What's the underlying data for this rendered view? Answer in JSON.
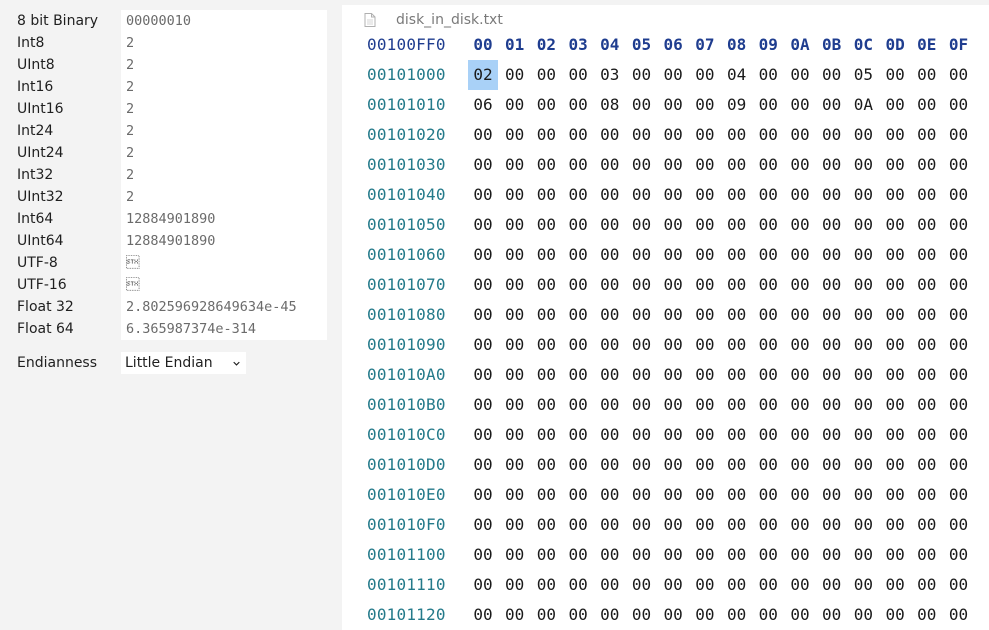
{
  "inspector": {
    "rows": [
      {
        "label": "8 bit Binary",
        "value": "00000010"
      },
      {
        "label": "Int8",
        "value": "2"
      },
      {
        "label": "UInt8",
        "value": "2"
      },
      {
        "label": "Int16",
        "value": "2"
      },
      {
        "label": "UInt16",
        "value": "2"
      },
      {
        "label": "Int24",
        "value": "2"
      },
      {
        "label": "UInt24",
        "value": "2"
      },
      {
        "label": "Int32",
        "value": "2"
      },
      {
        "label": "UInt32",
        "value": "2"
      },
      {
        "label": "Int64",
        "value": "12884901890"
      },
      {
        "label": "UInt64",
        "value": "12884901890"
      },
      {
        "label": "UTF-8",
        "value": "\u0002"
      },
      {
        "label": "UTF-16",
        "value": "\u0002"
      },
      {
        "label": "Float 32",
        "value": "2.802596928649634e-45"
      },
      {
        "label": "Float 64",
        "value": "6.365987374e-314"
      }
    ],
    "endianness": {
      "label": "Endianness",
      "selected": "Little Endian"
    }
  },
  "editor": {
    "tab_title": "disk_in_disk.txt",
    "header": {
      "address": "00100FF0",
      "columns": [
        "00",
        "01",
        "02",
        "03",
        "04",
        "05",
        "06",
        "07",
        "08",
        "09",
        "0A",
        "0B",
        "0C",
        "0D",
        "0E",
        "0F"
      ]
    },
    "selected": {
      "row": 0,
      "col": 0
    },
    "rows": [
      {
        "address": "00101000",
        "bytes": [
          "02",
          "00",
          "00",
          "00",
          "03",
          "00",
          "00",
          "00",
          "04",
          "00",
          "00",
          "00",
          "05",
          "00",
          "00",
          "00"
        ]
      },
      {
        "address": "00101010",
        "bytes": [
          "06",
          "00",
          "00",
          "00",
          "08",
          "00",
          "00",
          "00",
          "09",
          "00",
          "00",
          "00",
          "0A",
          "00",
          "00",
          "00"
        ]
      },
      {
        "address": "00101020",
        "bytes": [
          "00",
          "00",
          "00",
          "00",
          "00",
          "00",
          "00",
          "00",
          "00",
          "00",
          "00",
          "00",
          "00",
          "00",
          "00",
          "00"
        ]
      },
      {
        "address": "00101030",
        "bytes": [
          "00",
          "00",
          "00",
          "00",
          "00",
          "00",
          "00",
          "00",
          "00",
          "00",
          "00",
          "00",
          "00",
          "00",
          "00",
          "00"
        ]
      },
      {
        "address": "00101040",
        "bytes": [
          "00",
          "00",
          "00",
          "00",
          "00",
          "00",
          "00",
          "00",
          "00",
          "00",
          "00",
          "00",
          "00",
          "00",
          "00",
          "00"
        ]
      },
      {
        "address": "00101050",
        "bytes": [
          "00",
          "00",
          "00",
          "00",
          "00",
          "00",
          "00",
          "00",
          "00",
          "00",
          "00",
          "00",
          "00",
          "00",
          "00",
          "00"
        ]
      },
      {
        "address": "00101060",
        "bytes": [
          "00",
          "00",
          "00",
          "00",
          "00",
          "00",
          "00",
          "00",
          "00",
          "00",
          "00",
          "00",
          "00",
          "00",
          "00",
          "00"
        ]
      },
      {
        "address": "00101070",
        "bytes": [
          "00",
          "00",
          "00",
          "00",
          "00",
          "00",
          "00",
          "00",
          "00",
          "00",
          "00",
          "00",
          "00",
          "00",
          "00",
          "00"
        ]
      },
      {
        "address": "00101080",
        "bytes": [
          "00",
          "00",
          "00",
          "00",
          "00",
          "00",
          "00",
          "00",
          "00",
          "00",
          "00",
          "00",
          "00",
          "00",
          "00",
          "00"
        ]
      },
      {
        "address": "00101090",
        "bytes": [
          "00",
          "00",
          "00",
          "00",
          "00",
          "00",
          "00",
          "00",
          "00",
          "00",
          "00",
          "00",
          "00",
          "00",
          "00",
          "00"
        ]
      },
      {
        "address": "001010A0",
        "bytes": [
          "00",
          "00",
          "00",
          "00",
          "00",
          "00",
          "00",
          "00",
          "00",
          "00",
          "00",
          "00",
          "00",
          "00",
          "00",
          "00"
        ]
      },
      {
        "address": "001010B0",
        "bytes": [
          "00",
          "00",
          "00",
          "00",
          "00",
          "00",
          "00",
          "00",
          "00",
          "00",
          "00",
          "00",
          "00",
          "00",
          "00",
          "00"
        ]
      },
      {
        "address": "001010C0",
        "bytes": [
          "00",
          "00",
          "00",
          "00",
          "00",
          "00",
          "00",
          "00",
          "00",
          "00",
          "00",
          "00",
          "00",
          "00",
          "00",
          "00"
        ]
      },
      {
        "address": "001010D0",
        "bytes": [
          "00",
          "00",
          "00",
          "00",
          "00",
          "00",
          "00",
          "00",
          "00",
          "00",
          "00",
          "00",
          "00",
          "00",
          "00",
          "00"
        ]
      },
      {
        "address": "001010E0",
        "bytes": [
          "00",
          "00",
          "00",
          "00",
          "00",
          "00",
          "00",
          "00",
          "00",
          "00",
          "00",
          "00",
          "00",
          "00",
          "00",
          "00"
        ]
      },
      {
        "address": "001010F0",
        "bytes": [
          "00",
          "00",
          "00",
          "00",
          "00",
          "00",
          "00",
          "00",
          "00",
          "00",
          "00",
          "00",
          "00",
          "00",
          "00",
          "00"
        ]
      },
      {
        "address": "00101100",
        "bytes": [
          "00",
          "00",
          "00",
          "00",
          "00",
          "00",
          "00",
          "00",
          "00",
          "00",
          "00",
          "00",
          "00",
          "00",
          "00",
          "00"
        ]
      },
      {
        "address": "00101110",
        "bytes": [
          "00",
          "00",
          "00",
          "00",
          "00",
          "00",
          "00",
          "00",
          "00",
          "00",
          "00",
          "00",
          "00",
          "00",
          "00",
          "00"
        ]
      },
      {
        "address": "00101120",
        "bytes": [
          "00",
          "00",
          "00",
          "00",
          "00",
          "00",
          "00",
          "00",
          "00",
          "00",
          "00",
          "00",
          "00",
          "00",
          "00",
          "00"
        ]
      }
    ]
  },
  "icons": {
    "tab": "file-icon",
    "select": "chevron-down-icon"
  },
  "colors": {
    "address": "#247a8a",
    "header": "#1f3d8f",
    "selection": "#a9d1f7"
  }
}
